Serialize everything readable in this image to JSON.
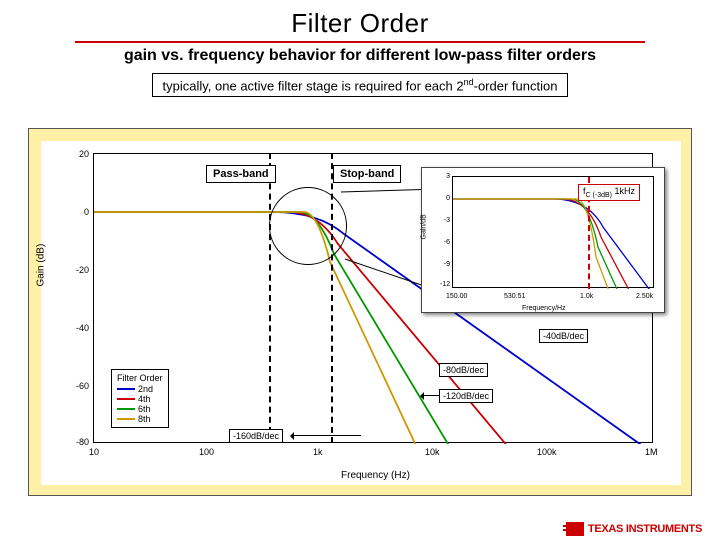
{
  "title": "Filter Order",
  "subtitle": "gain vs. frequency behavior for different low-pass filter orders",
  "note": "typically, one active filter stage is required for each 2",
  "note_sup": "nd",
  "note_tail": "-order function",
  "bands": {
    "pass": "Pass-band",
    "stop": "Stop-band"
  },
  "main_chart": {
    "ylabel": "Gain (dB)",
    "xlabel": "Frequency (Hz)",
    "yticks": [
      "20",
      "0",
      "-20",
      "-40",
      "-60",
      "-80"
    ],
    "xticks": [
      "10",
      "100",
      "1k",
      "10k",
      "100k",
      "1M"
    ]
  },
  "legend": {
    "title": "Filter Order",
    "items": [
      {
        "label": "2nd",
        "color": "#0000cc"
      },
      {
        "label": "4th",
        "color": "#cc0000"
      },
      {
        "label": "6th",
        "color": "#009900"
      },
      {
        "label": "8th",
        "color": "#cc9900"
      }
    ]
  },
  "slopes": {
    "s40": "-40dB/dec",
    "s80": "-80dB/dec",
    "s120": "-120dB/dec",
    "s160": "-160dB/dec"
  },
  "inset_chart": {
    "ylabel": "Gain/dB",
    "xlabel": "Frequency/Hz",
    "yticks": [
      "3",
      "0",
      "-3",
      "-6",
      "-9",
      "-12"
    ],
    "xticks": [
      "150.00",
      "530.51",
      "1.0k",
      "2.50k"
    ]
  },
  "fc": {
    "label_prefix": "f",
    "label_sub": "C (-3dB)",
    "value": " 1kHz"
  },
  "ti": "TEXAS INSTRUMENTS",
  "page": "",
  "chart_data": {
    "type": "line",
    "title": "Low-pass filter magnitude response vs. frequency for different orders",
    "xlabel": "Frequency (Hz)",
    "ylabel": "Gain (dB)",
    "x_scale": "log",
    "xlim": [
      10,
      1000000
    ],
    "ylim": [
      -80,
      20
    ],
    "fc_hz": 1000,
    "series": [
      {
        "name": "2nd",
        "color": "#0000cc",
        "slope_db_per_dec": -40,
        "x": [
          10,
          100,
          1000,
          10000,
          100000,
          1000000
        ],
        "y": [
          0,
          0,
          -3,
          -40,
          -80,
          -120
        ]
      },
      {
        "name": "4th",
        "color": "#cc0000",
        "slope_db_per_dec": -80,
        "x": [
          10,
          100,
          1000,
          10000,
          100000,
          1000000
        ],
        "y": [
          0,
          0,
          -3,
          -80,
          -160,
          -240
        ]
      },
      {
        "name": "6th",
        "color": "#009900",
        "slope_db_per_dec": -120,
        "x": [
          10,
          100,
          1000,
          10000,
          100000,
          1000000
        ],
        "y": [
          0,
          0,
          -3,
          -120,
          -240,
          -360
        ]
      },
      {
        "name": "8th",
        "color": "#cc9900",
        "slope_db_per_dec": -160,
        "x": [
          10,
          100,
          1000,
          10000,
          100000,
          1000000
        ],
        "y": [
          0,
          0,
          -3,
          -160,
          -320,
          -480
        ]
      }
    ],
    "inset": {
      "type": "line",
      "xlabel": "Frequency (Hz)",
      "ylabel": "Gain (dB)",
      "x_scale": "log",
      "xlim": [
        150,
        2500
      ],
      "ylim": [
        -12,
        3
      ],
      "fc_hz": 1000,
      "series_share_fc_at_minus3dB": true
    }
  }
}
